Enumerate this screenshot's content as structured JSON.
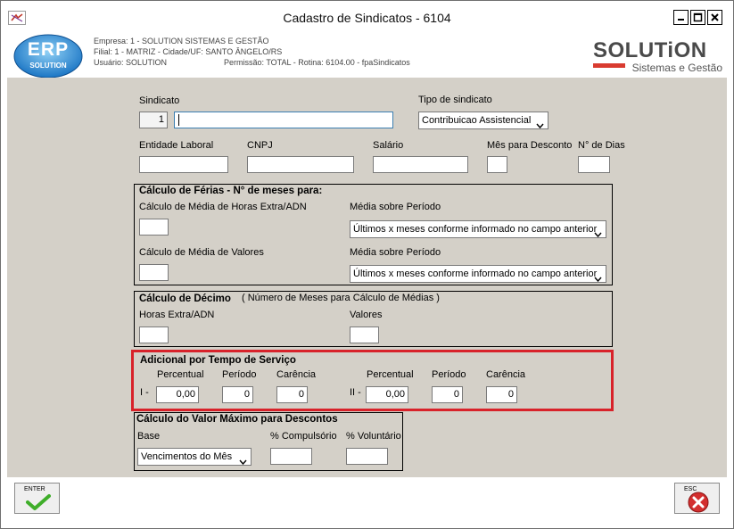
{
  "window": {
    "title": "Cadastro de Sindicatos - 6104"
  },
  "header": {
    "empresa": "Empresa: 1 - SOLUTION SISTEMAS E GESTÃO",
    "filial": "Filial: 1 - MATRIZ - Cidade/UF: SANTO ÂNGELO/RS",
    "usuario": "Usuário: SOLUTION",
    "permissao": "Permissão: TOTAL - Rotina: 6104.00 - fpaSindicatos",
    "logo_left_top": "ERP",
    "logo_left_bottom": "SOLUTION",
    "logo_right_name": "SOLUTiON",
    "logo_right_sub": "Sistemas e Gestão"
  },
  "form": {
    "sindicato_label": "Sindicato",
    "sindicato_code": "1",
    "sindicato_name": "",
    "tipo_label": "Tipo de sindicato",
    "tipo_value": "Contribuicao Assistencial",
    "entidade_label": "Entidade Laboral",
    "cnpj_label": "CNPJ",
    "salario_label": "Salário",
    "mes_desconto_label": "Mês para Desconto",
    "dias_label": "N° de Dias",
    "entidade_value": "",
    "cnpj_value": "",
    "salario_value": "",
    "mes_desconto_value": "",
    "dias_value": ""
  },
  "ferias": {
    "title": "Cálculo de Férias - N° de meses para:",
    "horas_label": "Cálculo de Média de Horas Extra/ADN",
    "horas_value": "",
    "media1_label": "Média sobre Período",
    "media1_value": "Últimos x meses conforme informado no campo anterior",
    "valores_label": "Cálculo de Média de Valores",
    "valores_value": "",
    "media2_label": "Média sobre Período",
    "media2_value": "Últimos x meses conforme informado no campo anterior"
  },
  "decimo": {
    "title": "Cálculo de Décimo",
    "subtitle": "( Número de Meses para Cálculo de Médias )",
    "horas_label": "Horas Extra/ADN",
    "horas_value": "",
    "valores_label": "Valores",
    "valores_value": ""
  },
  "adicional": {
    "title": "Adicional por Tempo de Serviço",
    "percentual_label": "Percentual",
    "periodo_label": "Período",
    "carencia_label": "Carência",
    "row1_label": "I -",
    "row1_percentual": "0,00",
    "row1_periodo": "0",
    "row1_carencia": "0",
    "row2_label": "II -",
    "row2_percentual": "0,00",
    "row2_periodo": "0",
    "row2_carencia": "0"
  },
  "maximo": {
    "title": "Cálculo do Valor Máximo para Descontos",
    "base_label": "Base",
    "base_value": "Vencimentos do Mês",
    "compulsorio_label": "% Compulsório",
    "compulsorio_value": "",
    "voluntario_label": "% Voluntário",
    "voluntario_value": ""
  },
  "footer": {
    "enter_label": "ENTER",
    "esc_label": "ESC"
  },
  "colors": {
    "form_bg": "#d4d0c8",
    "highlight_frame": "#d8222a",
    "accept_check": "#3fae2a",
    "cancel_red": "#d32f2f"
  }
}
